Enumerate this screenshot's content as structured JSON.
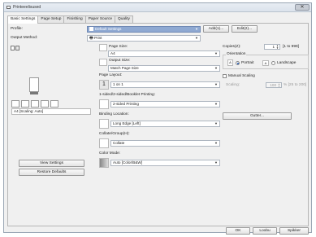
{
  "window": {
    "title": "Printeeelisused",
    "close_glyph": "✕"
  },
  "tabs": [
    "Basic Settings",
    "Page Setup",
    "Finishing",
    "Paper Source",
    "Quality"
  ],
  "profile": {
    "label": "Profile:",
    "value": "Default Settings",
    "add": "Add(1)...",
    "edit": "Edit(2)..."
  },
  "output_method": {
    "label": "Output Method:",
    "value": "Print"
  },
  "preview": {
    "status": "A4 [Scaling: Auto]"
  },
  "left_buttons": {
    "view": "View Settings",
    "restore": "Restore Defaults"
  },
  "page_size": {
    "label": "Page Size:",
    "value": "A4"
  },
  "output_size": {
    "label": "Output Size:",
    "value": "Match Page Size"
  },
  "page_layout": {
    "label": "Page Layout:",
    "value": "1 on 1",
    "badge": "1"
  },
  "sided": {
    "label": "1-sided/2-sided/Booklet Printing:",
    "value": "2-sided Printing"
  },
  "binding": {
    "label": "Binding Location:",
    "value": "Long Edge [Left]",
    "gutter": "Gutter..."
  },
  "collate": {
    "label": "Collate/Group(H):",
    "value": "Collate"
  },
  "color_mode": {
    "label": "Color Mode:",
    "value": "Auto [Color/B&W]"
  },
  "copies": {
    "label": "Copies(Z):",
    "value": "1",
    "range": "[1 to 999]"
  },
  "orientation": {
    "label": "Orientation",
    "portrait": "Portrait",
    "landscape": "Landscape",
    "selected": "Portrait"
  },
  "manual_scaling": {
    "label": "Manual Scaling",
    "scaling_label": "Scaling:",
    "value": "100",
    "range": "% [25 to 200]"
  },
  "footer": {
    "ok": "OK",
    "cancel": "Loobu",
    "apply": "Spikker"
  },
  "colors": {
    "accent_blue": "#8fa9d2",
    "window_bg": "#f0f0f0"
  }
}
